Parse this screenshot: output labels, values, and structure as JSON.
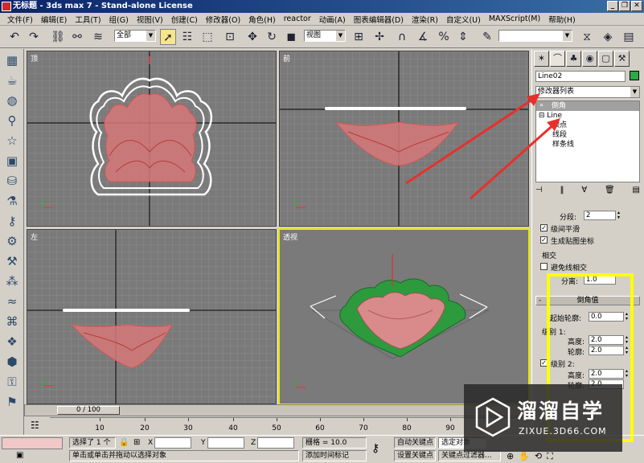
{
  "window": {
    "title": "无标题 - 3ds max 7 - Stand-alone License",
    "minimize": "_",
    "restore": "❐",
    "close": "✕"
  },
  "menu": [
    "文件(F)",
    "编辑(E)",
    "工具(T)",
    "组(G)",
    "视图(V)",
    "创建(C)",
    "修改器(O)",
    "角色(H)",
    "reactor",
    "动画(A)",
    "图表编辑器(D)",
    "渲染(R)",
    "自定义(U)",
    "MAXScript(M)",
    "帮助(H)"
  ],
  "toolbar": {
    "selection_filter": "全部",
    "reference_coord": "视图",
    "named_selection": ""
  },
  "viewports": {
    "top": "顶",
    "front": "前",
    "left": "左",
    "perspective": "透视"
  },
  "command_panel": {
    "object_name": "Line02",
    "object_color": "#2ea84a",
    "modifier_list": "修改器列表",
    "stack": {
      "bevel": "倒角",
      "line": "Line",
      "vertex": "顶点",
      "segment": "线段",
      "spline": "样条线"
    },
    "segments_label": "分段:",
    "segments_value": "2",
    "smooth_across_levels": "级间平滑",
    "generate_mapping": "生成贴图坐标",
    "intersections_title": "相交",
    "keep_lines_from_crossing": "避免线相交",
    "separation_label": "分离:",
    "separation_value": "1.0",
    "bevel_values_title": "倒角值",
    "start_outline_label": "起始轮廓:",
    "start_outline_value": "0.0",
    "level1_label": "级别 1:",
    "height_label": "高度:",
    "level1_height": "2.0",
    "outline_label": "轮廓:",
    "level1_outline": "2.0",
    "level2_label": "级别 2:",
    "level2_height": "2.0",
    "level2_outline": "2.0"
  },
  "timeline": {
    "slider": "0 / 100",
    "ticks": [
      "10",
      "20",
      "30",
      "40",
      "50",
      "60",
      "70",
      "80",
      "90"
    ]
  },
  "status": {
    "selected": "选择了 1 个",
    "x_label": "X",
    "y_label": "Y",
    "z_label": "Z",
    "grid": "栅格 = 10.0",
    "autokey": "自动关键点",
    "selected_set": "选定对象",
    "setkey": "设置关键点",
    "key_filters": "关键点过滤器...",
    "prompt": "单击或单击并拖动以选择对象",
    "add_time_tag": "添加时间标记"
  },
  "watermark": {
    "brand_cn": "溜溜自学",
    "brand_en": "ZIXUE.3D66.COM"
  }
}
